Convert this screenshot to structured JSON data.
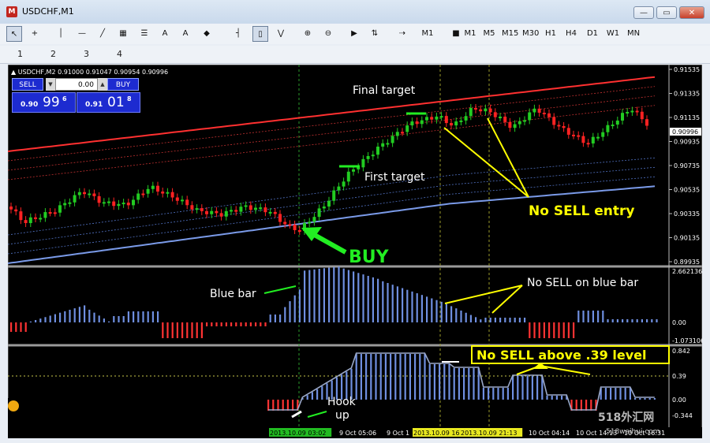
{
  "window": {
    "title": "USDCHF,M1",
    "minimize": "—",
    "restore": "▭",
    "close": "✕"
  },
  "toolbar": {
    "items": [
      "↖",
      "+",
      "│",
      "—",
      "╱",
      "▦",
      "☰",
      "A",
      "A",
      "◆",
      "┤",
      "▯",
      "⋁",
      "⊕",
      "⊖",
      "▶",
      "⇅",
      "⇢",
      "M1",
      "■",
      "M1",
      "M5",
      "M15",
      "M30",
      "H1",
      "H4",
      "D1",
      "W1",
      "MN"
    ]
  },
  "tabs": [
    "1",
    "2",
    "3",
    "4"
  ],
  "chart": {
    "header": "▲ USDCHF,M2  0.91000 0.91047 0.90954 0.90996",
    "price_ticks": [
      "0.91535",
      "0.91335",
      "0.91135",
      "0.90935",
      "0.90735",
      "0.90535",
      "0.90335",
      "0.90135",
      "0.89935"
    ],
    "current_price": "0.90996",
    "indicator1_ticks": [
      "2.662136",
      "0.00",
      "-1.073106"
    ],
    "indicator2_ticks": [
      "0.842",
      "0.39",
      "0.00",
      "-0.344"
    ],
    "time_labels": [
      "2013.10.09 03:02",
      "9 Oct 05:06",
      "9 Oct 1",
      "2013.10.09 16",
      "2013.10.09 21:13",
      "10 Oct 04:14",
      "10 Oct 14:13",
      "10 Oct 16:31"
    ],
    "colors": {
      "bull": "#22cc22",
      "bear": "#ff2222",
      "hist_blue": "#6f8fe0",
      "hist_red": "#ff3333",
      "note_green": "#22ee22",
      "note_yellow": "#ffff00"
    }
  },
  "trade_panel": {
    "sell_label": "SELL",
    "buy_label": "BUY",
    "lot": "0.00",
    "sell_small": "0.90",
    "sell_big": "99",
    "sell_sup": "6",
    "buy_small": "0.91",
    "buy_big": "01",
    "buy_sup": "8"
  },
  "annotations": {
    "final_target": "Final target",
    "first_target": "First target",
    "no_sell_entry": "No SELL entry",
    "buy": "BUY",
    "blue_bar": "Blue bar",
    "no_sell_blue": "No SELL on blue bar",
    "no_sell_level": "No SELL above .39 level",
    "hook_line1": "Hook",
    "hook_line2": "up"
  },
  "watermark": {
    "line1": "518外汇网",
    "line2": "518waihui.com"
  }
}
